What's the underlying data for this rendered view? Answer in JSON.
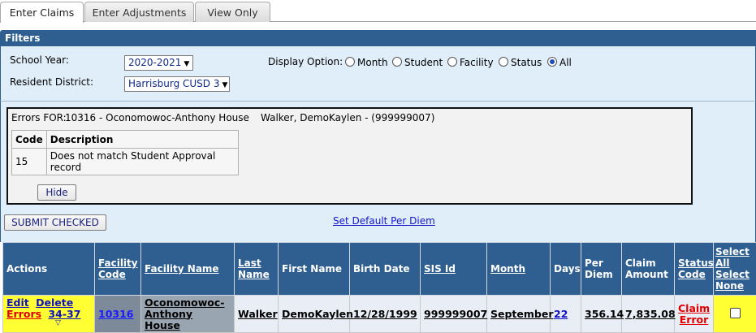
{
  "tabs": [
    {
      "label": "Enter Claims"
    },
    {
      "label": "Enter Adjustments"
    },
    {
      "label": "View Only"
    }
  ],
  "filters": {
    "header": "Filters",
    "school_year_label": "School Year:",
    "school_year_value": "2020-2021",
    "resident_district_label": "Resident District:",
    "resident_district_value": "Harrisburg CUSD 3",
    "display_option_label": "Display Option:",
    "display_options": [
      "Month",
      "Student",
      "Facility",
      "Status",
      "All"
    ],
    "display_selected": "All"
  },
  "errors": {
    "prefix": "Errors FOR:",
    "detail": "10316 - Oconomowoc-Anthony House",
    "student": "Walker, DemoKaylen - (999999007)",
    "col_code": "Code",
    "col_description": "Description",
    "rows": [
      {
        "code": "15",
        "description": "Does not match Student Approval record"
      }
    ],
    "hide_label": "Hide"
  },
  "actions": {
    "submit_checked": "SUBMIT CHECKED",
    "set_default": "Set Default Per Diem"
  },
  "grid": {
    "headers": {
      "actions": "Actions",
      "facility_code": "Facility Code",
      "facility_name": "Facility Name",
      "last_name": "Last Name",
      "first_name": "First Name",
      "birth_date": "Birth Date",
      "sis_id": "SIS Id",
      "month": "Month",
      "days": "Days",
      "per_diem": "Per Diem",
      "claim_amount": "Claim Amount",
      "status_code": "Status Code",
      "select_all": "Select All",
      "select_none": "Select None"
    },
    "row": {
      "edit": "Edit",
      "delete": "Delete",
      "errors": "Errors",
      "error_codes": "34-37",
      "facility_code": "10316",
      "facility_name": "Oconomowoc-Anthony House",
      "last_name": "Walker",
      "first_name": "DemoKaylen",
      "birth_date": "12/28/1999",
      "sis_id": "999999007",
      "month": "September",
      "days": "22",
      "per_diem": "356.14",
      "claim_amount": "7,835.08",
      "status": "Claim Error"
    }
  }
}
